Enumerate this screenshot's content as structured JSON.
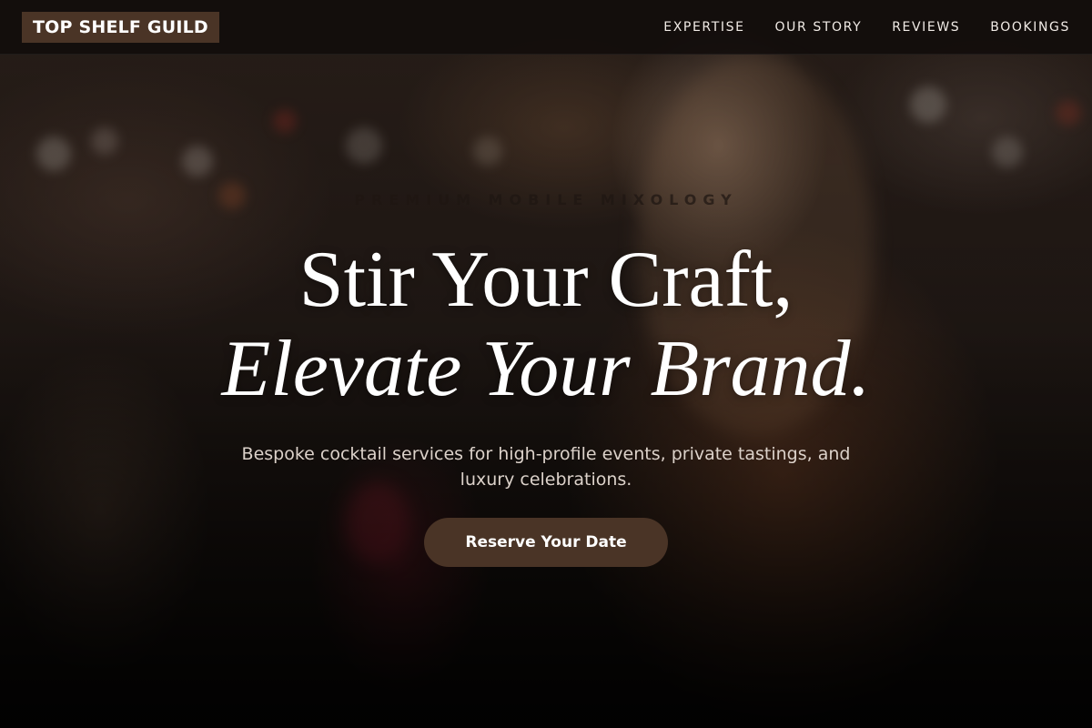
{
  "brand": {
    "name": "TOP SHELF GUILD"
  },
  "nav": {
    "items": [
      {
        "label": "EXPERTISE"
      },
      {
        "label": "OUR STORY"
      },
      {
        "label": "REVIEWS"
      },
      {
        "label": "BOOKINGS"
      }
    ]
  },
  "hero": {
    "eyebrow": "PREMIUM MOBILE MIXOLOGY",
    "headline_line1": "Stir Your Craft,",
    "headline_line2": "Elevate Your Brand.",
    "subtext": "Bespoke cocktail services for high-profile events, private tastings, and luxury celebrations.",
    "cta_label": "Reserve Your Date"
  },
  "colors": {
    "accent": "#4a3426",
    "nav_background": "#100c0a",
    "text_primary": "#ffffff"
  }
}
